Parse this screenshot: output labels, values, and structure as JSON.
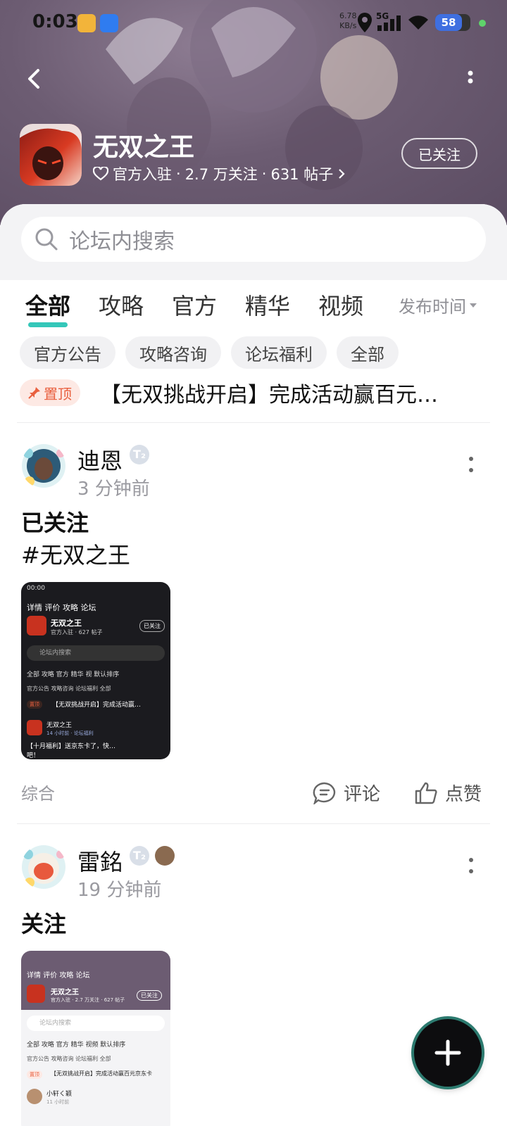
{
  "status_bar": {
    "time": "0:03",
    "speed_value": "6.78",
    "speed_unit": "KB/s",
    "network": "5G",
    "battery": "58"
  },
  "forum": {
    "title": "无双之王",
    "meta_official": "官方入驻",
    "meta_followers": "2.7 万关注",
    "meta_posts": "631 帖子",
    "follow_button": "已关注"
  },
  "search": {
    "placeholder": "论坛内搜索"
  },
  "tabs": [
    {
      "label": "全部",
      "active": true
    },
    {
      "label": "攻略",
      "active": false
    },
    {
      "label": "官方",
      "active": false
    },
    {
      "label": "精华",
      "active": false
    },
    {
      "label": "视频",
      "active": false
    }
  ],
  "sort": {
    "label": "发布时间"
  },
  "chips": [
    "官方公告",
    "攻略咨询",
    "论坛福利",
    "全部"
  ],
  "pinned": {
    "badge": "置顶",
    "title": "【无双挑战开启】完成活动赢百元…"
  },
  "posts": [
    {
      "author": "迪恩",
      "badge": "T₂",
      "time": "3 分钟前",
      "lines": [
        "已关注",
        "#无双之王"
      ],
      "category": "综合",
      "comment_label": "评论",
      "like_label": "点赞",
      "thumbnail": {
        "tabs": "详情 评价 攻略 论坛",
        "forum": "无双之王",
        "meta": "官方入驻 · 627 帖子",
        "followed": "已关注",
        "search": "论坛内搜索",
        "tab_row": "全部 攻略 官方 精华 视 默认排序",
        "chip_row": "官方公告 攻略咨询 论坛福利 全部",
        "pinned": "【无双挑战开启】完成活动赢…",
        "pinned_badge": "置顶",
        "post_author": "无双之王",
        "post_time": "14 小时前 · 论坛福利",
        "post_text": "【十月福利】送京东卡了，快…",
        "post_text2": "吧！"
      }
    },
    {
      "author": "雷銘",
      "badge": "T₂",
      "time": "19 分钟前",
      "lines": [
        "关注"
      ],
      "thumbnail": {
        "tabs": "详情 评价 攻略 论坛",
        "forum": "无双之王",
        "meta": "官方入驻 · 2.7 万关注 · 627 帖子",
        "followed": "已关注",
        "search": "论坛内搜索",
        "tab_row": "全部 攻略 官方 精华 视频 默认排序",
        "chip_row": "官方公告 攻略咨询 论坛福利 全部",
        "pinned_badge": "置顶",
        "pinned": "【无双挑战开启】完成活动赢百元京东卡",
        "post_author": "小轩く颖",
        "post_time": "11 小时前"
      }
    }
  ],
  "colors": {
    "accent": "#34c7b9",
    "pin": "#e9603f",
    "header": "#6c5c72"
  },
  "icons": [
    "back-arrow-icon",
    "more-vertical-icon",
    "heart-icon",
    "search-icon",
    "pin-icon",
    "comment-icon",
    "thumb-up-icon",
    "plus-icon"
  ]
}
